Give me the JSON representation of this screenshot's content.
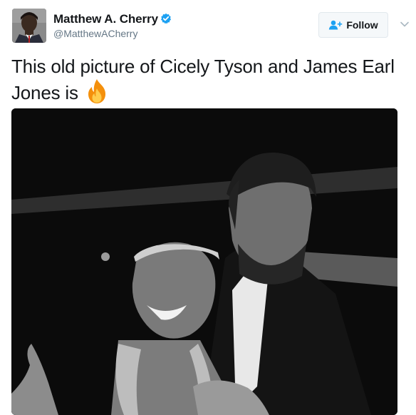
{
  "tweet": {
    "display_name": "Matthew A. Cherry",
    "handle": "@MatthewACherry",
    "text": "This old picture of Cicely Tyson and James Earl Jones is",
    "text_emoji": "fire-icon"
  },
  "follow_button": {
    "label": "Follow"
  },
  "icons": {
    "verified": "verified-badge-icon",
    "follow": "add-user-icon",
    "menu": "chevron-down-icon"
  },
  "colors": {
    "name": "#14171a",
    "handle": "#657786",
    "verified": "#1da1f2",
    "follow_icon": "#1da1f2",
    "button_bg": "#f5f8fa",
    "button_border": "#e1e8ed",
    "photo_bg": "#0b0b0b"
  }
}
